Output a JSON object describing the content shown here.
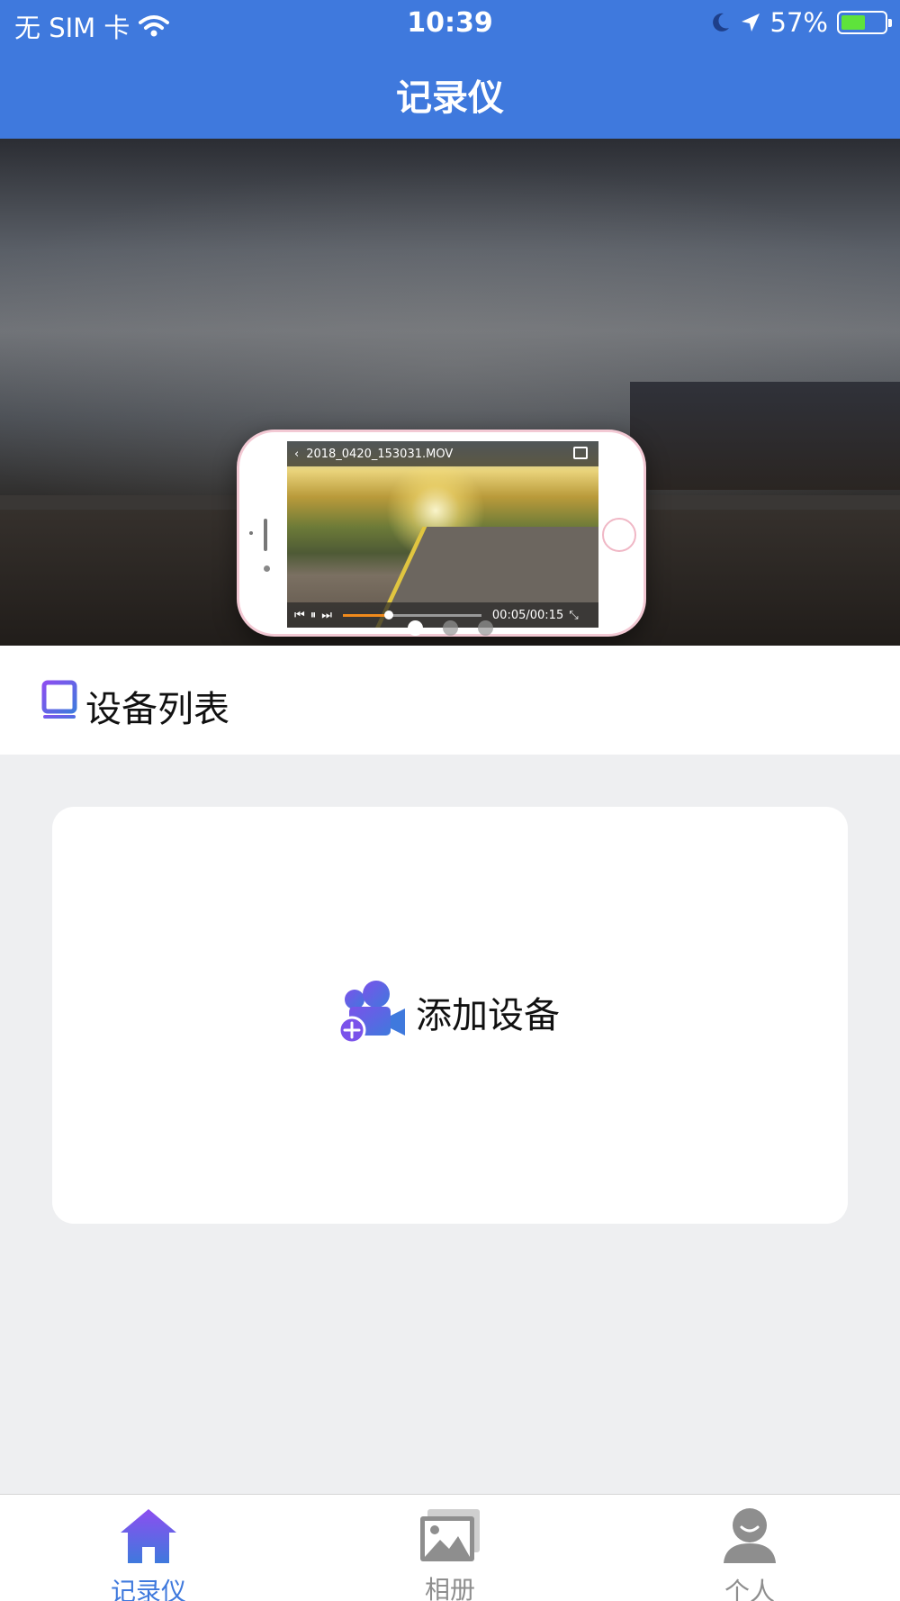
{
  "status_bar": {
    "carrier": "无 SIM 卡",
    "time": "10:39",
    "battery": "57%",
    "battery_level": 0.57,
    "icons": [
      "wifi-icon",
      "moon-icon",
      "location-arrow-icon",
      "battery-icon"
    ]
  },
  "header": {
    "title": "记录仪",
    "color": "#3f79dd"
  },
  "banner": {
    "video_filename": "2018_0420_153031.MOV",
    "video_time": "00:05/00:15",
    "progress": 0.33,
    "page_count": 3,
    "active_page": 0
  },
  "section": {
    "title": "设备列表",
    "icon": "device-list-icon"
  },
  "device_card": {
    "add_label": "添加设备",
    "icon": "add-camera-icon"
  },
  "tabbar": {
    "tabs": [
      {
        "label": "记录仪",
        "icon": "home-icon",
        "active": true
      },
      {
        "label": "相册",
        "icon": "album-icon",
        "active": false
      },
      {
        "label": "个人",
        "icon": "person-icon",
        "active": false
      }
    ],
    "active_color": "#3f79dd",
    "inactive_color": "#8e8e8e"
  }
}
